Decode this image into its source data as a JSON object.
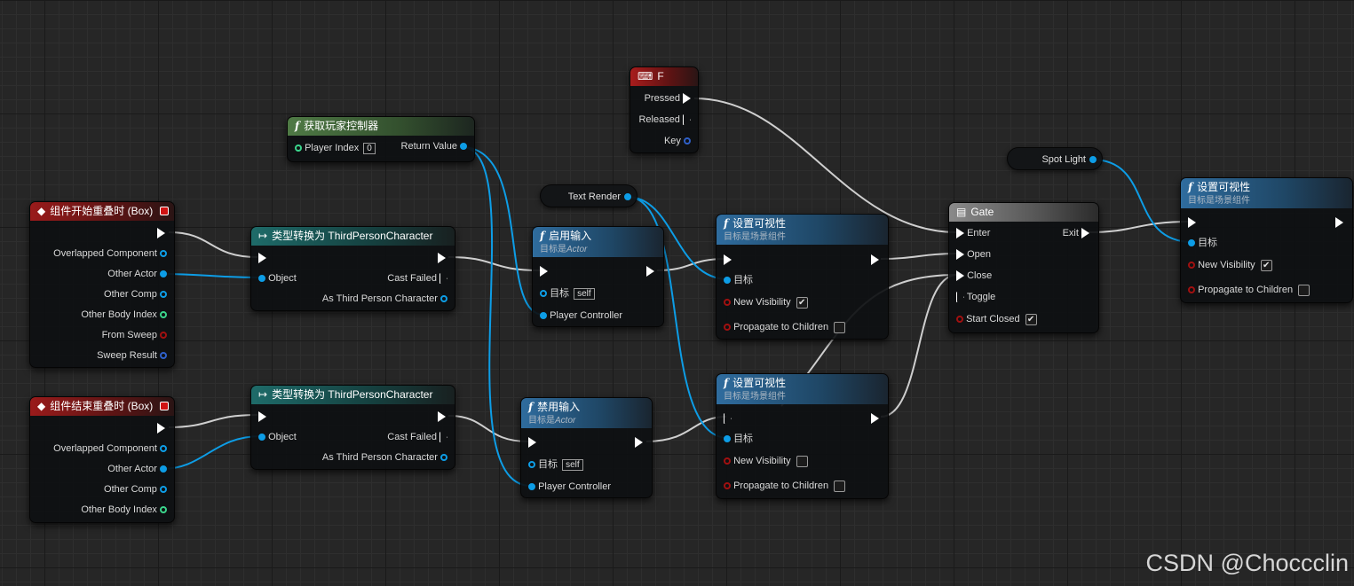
{
  "nodes": {
    "begin_overlap": {
      "title": "组件开始重叠时 (Box)",
      "pins": [
        "Overlapped Component",
        "Other Actor",
        "Other Comp",
        "Other Body Index",
        "From Sweep",
        "Sweep Result"
      ]
    },
    "end_overlap": {
      "title": "组件结束重叠时 (Box)",
      "pins": [
        "Overlapped Component",
        "Other Actor",
        "Other Comp",
        "Other Body Index"
      ]
    },
    "cast_top": {
      "title": "类型转换为 ThirdPersonCharacter",
      "object": "Object",
      "cast_failed": "Cast Failed",
      "as_char": "As Third Person Character"
    },
    "cast_bottom": {
      "title": "类型转换为 ThirdPersonCharacter",
      "object": "Object",
      "cast_failed": "Cast Failed",
      "as_char": "As Third Person Character"
    },
    "get_player_controller": {
      "title": "获取玩家控制器",
      "player_index": "Player Index",
      "player_index_value": "0",
      "return_value": "Return Value"
    },
    "enable_input": {
      "title": "启用输入",
      "subtitle_prefix": "目标是",
      "subtitle_em": "Actor",
      "target": "目标",
      "target_value": "self",
      "player_controller": "Player Controller"
    },
    "disable_input": {
      "title": "禁用输入",
      "subtitle_prefix": "目标是",
      "subtitle_em": "Actor",
      "target": "目标",
      "target_value": "self",
      "player_controller": "Player Controller"
    },
    "key_f": {
      "title": "F",
      "pressed": "Pressed",
      "released": "Released",
      "key": "Key"
    },
    "text_render": {
      "label": "Text Render"
    },
    "spot_light": {
      "label": "Spot Light"
    },
    "set_vis_1": {
      "title": "设置可视性",
      "subtitle": "目标是场景组件",
      "target": "目标",
      "new_visibility": "New Visibility",
      "new_visibility_checked": "✔",
      "propagate": "Propagate to Children",
      "propagate_checked": ""
    },
    "set_vis_2": {
      "title": "设置可视性",
      "subtitle": "目标是场景组件",
      "target": "目标",
      "new_visibility": "New Visibility",
      "new_visibility_checked": "",
      "propagate": "Propagate to Children",
      "propagate_checked": ""
    },
    "set_vis_3": {
      "title": "设置可视性",
      "subtitle": "目标是场景组件",
      "target": "目标",
      "new_visibility": "New Visibility",
      "new_visibility_checked": "✔",
      "propagate": "Propagate to Children",
      "propagate_checked": ""
    },
    "gate": {
      "title": "Gate",
      "enter": "Enter",
      "open": "Open",
      "close": "Close",
      "toggle": "Toggle",
      "start_closed": "Start Closed",
      "start_closed_checked": "✔",
      "exit": "Exit"
    }
  },
  "watermark": "CSDN @Choccclin",
  "colors": {
    "exec": "#ffffff",
    "object_pin": "#0d9de6",
    "wire_exec": "#cfcfcf",
    "wire_object": "#0d9de6"
  },
  "icons": {
    "event": "event-diamond-icon",
    "function": "function-f-icon",
    "cast": "cast-arrow-icon",
    "input_key": "keyboard-icon",
    "macro": "macro-gate-icon"
  }
}
